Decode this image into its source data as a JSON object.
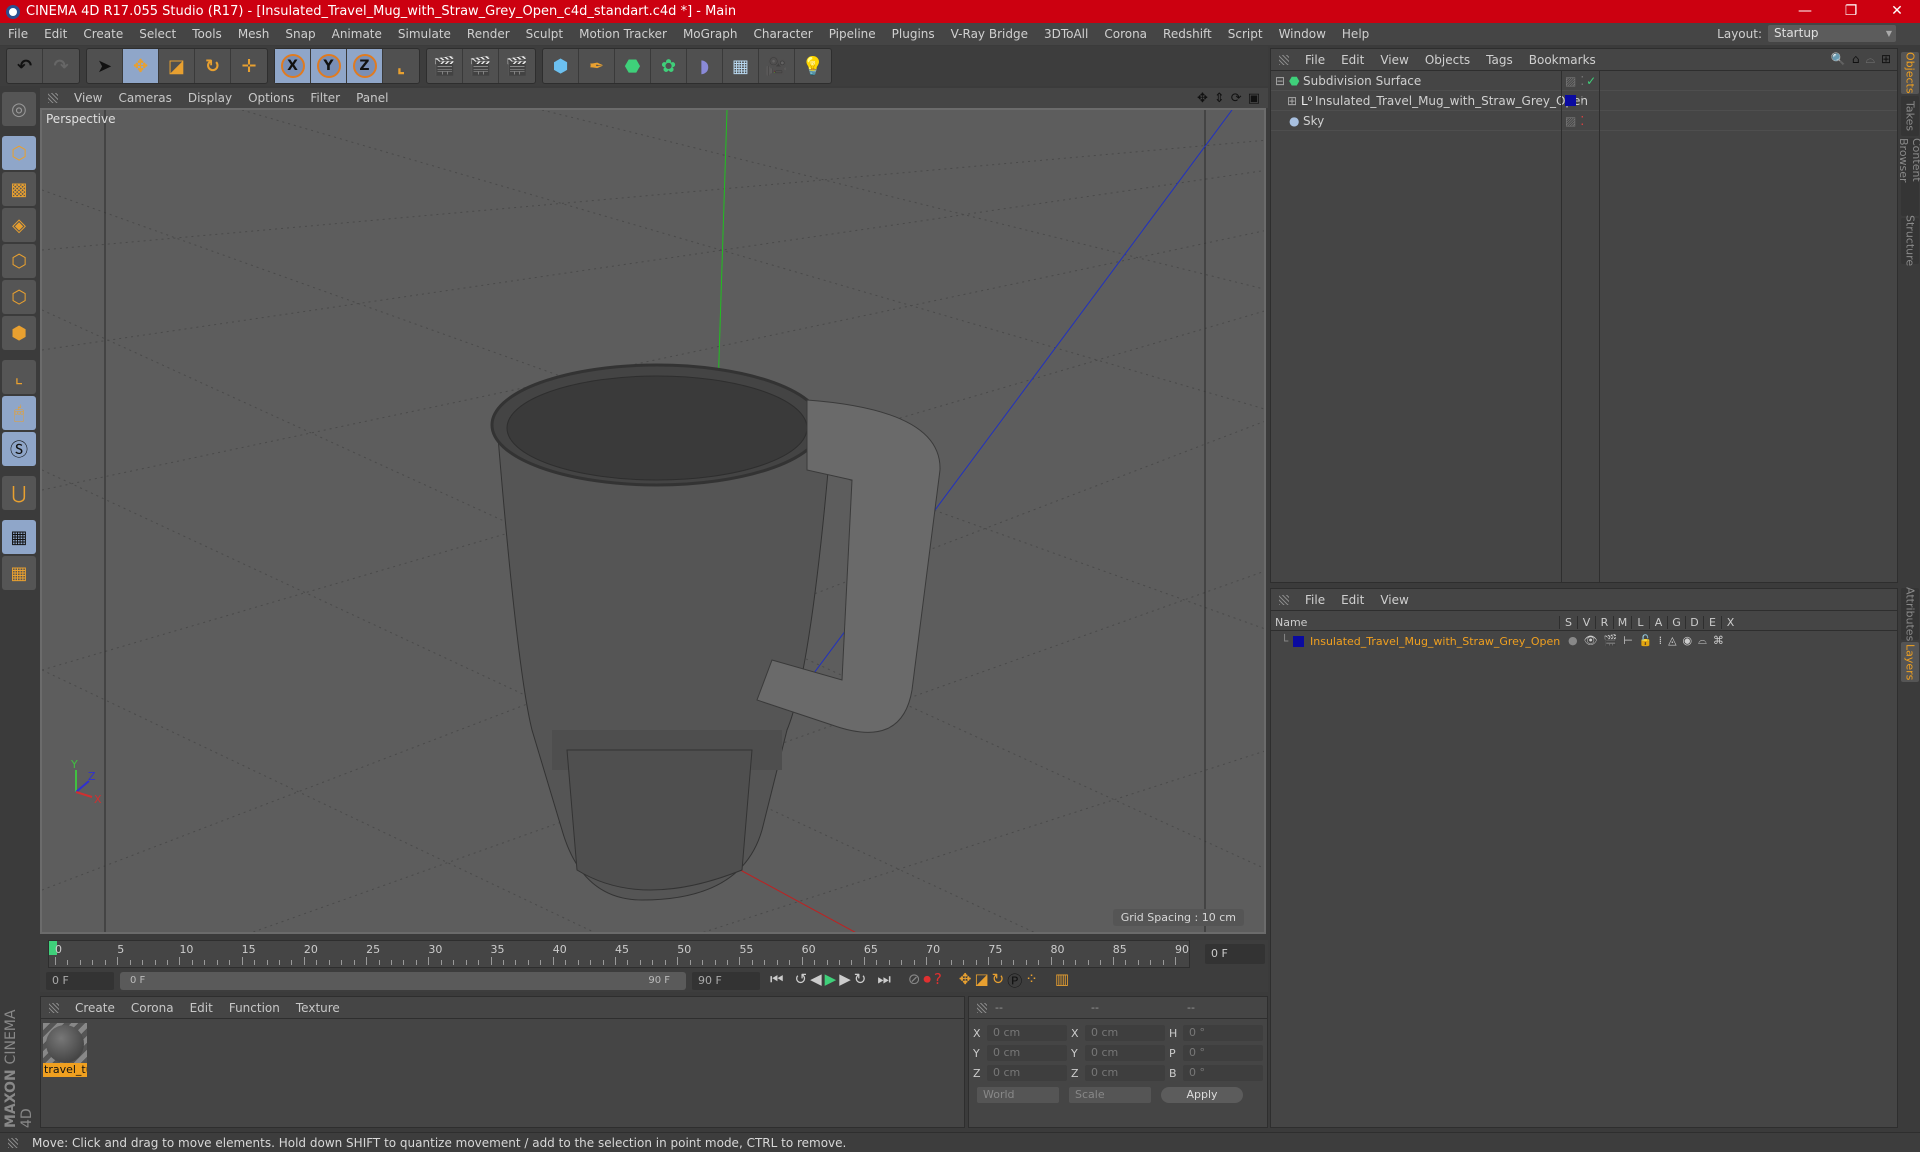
{
  "window": {
    "title": "CINEMA 4D R17.055 Studio (R17) - [Insulated_Travel_Mug_with_Straw_Grey_Open_c4d_standart.c4d *] - Main",
    "controls": {
      "minimize": "—",
      "maximize": "❐",
      "close": "✕"
    }
  },
  "menubar": {
    "items": [
      "File",
      "Edit",
      "Create",
      "Select",
      "Tools",
      "Mesh",
      "Snap",
      "Animate",
      "Simulate",
      "Render",
      "Sculpt",
      "Motion Tracker",
      "MoGraph",
      "Character",
      "Pipeline",
      "Plugins",
      "V-Ray Bridge",
      "3DToAll",
      "Corona",
      "Redshift",
      "Script",
      "Window",
      "Help"
    ],
    "layout_label": "Layout:",
    "layout_value": "Startup"
  },
  "toolbar": {
    "undo": "undo-icon",
    "redo": "redo-icon",
    "tools": [
      "select",
      "move",
      "scale",
      "rotate",
      "recent-tool"
    ],
    "axes": [
      "X",
      "Y",
      "Z"
    ],
    "coord_system": "world-coordinates-icon",
    "render": [
      "render-view",
      "render-picture-viewer",
      "edit-render-settings"
    ],
    "create": [
      "cube",
      "pen-spline",
      "subdivision-surface",
      "array",
      "deformer",
      "floor",
      "camera",
      "light"
    ]
  },
  "viewport": {
    "menu": [
      "View",
      "Cameras",
      "Display",
      "Options",
      "Filter",
      "Panel"
    ],
    "label": "Perspective",
    "grid_spacing": "Grid Spacing : 10 cm",
    "axis_labels": {
      "x": "X",
      "y": "Y",
      "z": "Z"
    },
    "nav_icons": [
      "move-view-icon",
      "dolly-view-icon",
      "rotate-view-icon",
      "toggle-layout-icon"
    ]
  },
  "left_tools": [
    "make-editable",
    "model-mode",
    "texture-mode",
    "workplane-mode",
    "points-mode",
    "edges-mode",
    "polygons-mode",
    "axis-mode",
    "tweak-mode",
    "solo-mode",
    "snap",
    "workplane-lock",
    "workplane-sync"
  ],
  "timeline": {
    "ticks": [
      "0",
      "5",
      "10",
      "15",
      "20",
      "25",
      "30",
      "35",
      "40",
      "45",
      "50",
      "55",
      "60",
      "65",
      "70",
      "75",
      "80",
      "85",
      "90"
    ],
    "current_frame": "0 F",
    "start_frame": "0 F",
    "range_start": "0 F",
    "range_end": "90 F",
    "end_frame": "90 F",
    "playhead": 0
  },
  "material_manager": {
    "menu": [
      "Create",
      "Corona",
      "Edit",
      "Function",
      "Texture"
    ],
    "materials": [
      {
        "name": "travel_tu"
      }
    ]
  },
  "brand": {
    "maxon": "MAXON",
    "product": "CINEMA 4D"
  },
  "coordinates": {
    "headers": [
      "--",
      "--",
      "--"
    ],
    "rows": [
      {
        "a": "X",
        "av": "0 cm",
        "b": "X",
        "bv": "0 cm",
        "c": "H",
        "cv": "0 °"
      },
      {
        "a": "Y",
        "av": "0 cm",
        "b": "Y",
        "bv": "0 cm",
        "c": "P",
        "cv": "0 °"
      },
      {
        "a": "Z",
        "av": "0 cm",
        "b": "Z",
        "bv": "0 cm",
        "c": "B",
        "cv": "0 °"
      }
    ],
    "mode": "World",
    "type": "Scale",
    "apply": "Apply"
  },
  "object_manager": {
    "menu": [
      "File",
      "Edit",
      "View",
      "Objects",
      "Tags",
      "Bookmarks"
    ],
    "objects": [
      {
        "name": "Subdivision Surface",
        "icon": "subdivision-icon",
        "indent": 0
      },
      {
        "name": "Insulated_Travel_Mug_with_Straw_Grey_Open",
        "icon": "null-object-icon",
        "indent": 1,
        "color": "#0a0aa0"
      },
      {
        "name": "Sky",
        "icon": "sky-icon",
        "indent": 0
      }
    ]
  },
  "layer_manager": {
    "menu": [
      "File",
      "Edit",
      "View"
    ],
    "columns": [
      "Name",
      "S",
      "V",
      "R",
      "M",
      "L",
      "A",
      "G",
      "D",
      "E",
      "X"
    ],
    "layers": [
      {
        "name": "Insulated_Travel_Mug_with_Straw_Grey_Open",
        "color": "#0a0aa0"
      }
    ]
  },
  "side_tabs": {
    "top": [
      "Objects",
      "Takes",
      "Content Browser",
      "Structure"
    ],
    "bottom": [
      "Attributes",
      "Layers"
    ]
  },
  "status": "Move: Click and drag to move elements. Hold down SHIFT to quantize movement / add to the selection in point mode, CTRL to remove.",
  "colors": {
    "title_bar": "#cc0010",
    "accent": "#f0a020",
    "active_tool": "#8fa6c9"
  }
}
